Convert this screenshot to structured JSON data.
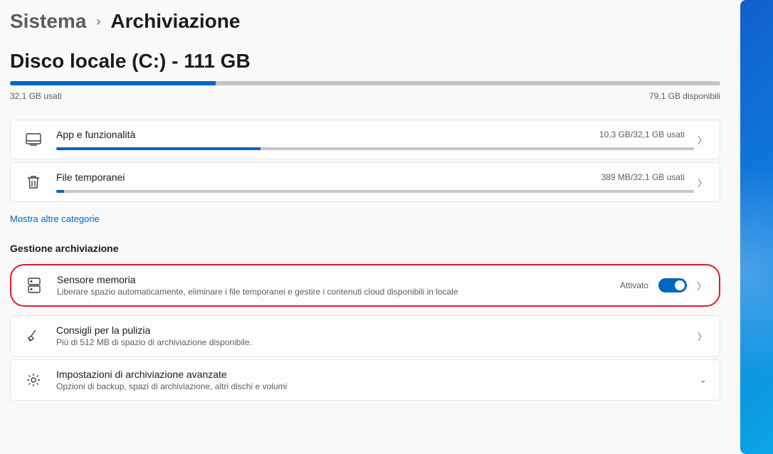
{
  "breadcrumb": {
    "parent": "Sistema",
    "current": "Archiviazione"
  },
  "disk": {
    "title": "Disco locale (C:) - 111 GB",
    "used_pct": 29,
    "used_label": "32,1 GB usati",
    "free_label": "79,1 GB disponibili"
  },
  "categories": [
    {
      "icon": "apps",
      "title": "App e funzionalità",
      "right": "10,3 GB/32,1 GB usati",
      "bar_pct": 32
    },
    {
      "icon": "trash",
      "title": "File temporanei",
      "right": "389 MB/32,1 GB usati",
      "bar_pct": 1.2
    }
  ],
  "more_link": "Mostra altre categorie",
  "section_title": "Gestione archiviazione",
  "storage_sense": {
    "title": "Sensore memoria",
    "sub": "Liberare spazio automaticamente, eliminare i file temporanei e gestire i contenuti cloud disponibili in locale",
    "state_label": "Attivato",
    "enabled": true
  },
  "cleanup": {
    "title": "Consigli per la pulizia",
    "sub": "Più di 512 MB di spazio di archiviazione disponibile."
  },
  "advanced": {
    "title": "Impostazioni di archiviazione avanzate",
    "sub": "Opzioni di backup, spazi di archiviazione, altri dischi e volumi"
  }
}
